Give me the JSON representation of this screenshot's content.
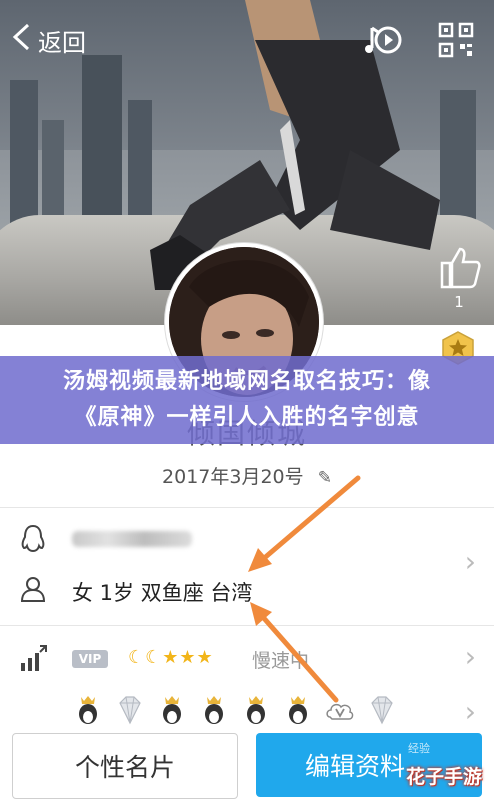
{
  "header": {
    "back_label": "返回",
    "icons": [
      "chevron-left-icon",
      "music-note-icon",
      "qr-code-icon"
    ]
  },
  "like": {
    "count": "1",
    "icon": "thumbs-up-icon"
  },
  "banner": {
    "line1": "汤姆视频最新地域网名取名技巧：像",
    "line2": "《原神》一样引人入胜的名字创意"
  },
  "profile": {
    "nickname": "倾国倾城",
    "date": "2017年3月20号",
    "edit_icon": "pencil-icon"
  },
  "info": {
    "qq_icon": "penguin-outline-icon",
    "person_icon": "person-outline-icon",
    "details": "女  1岁  双鱼座  台湾",
    "level_icon": "bar-chart-up-icon",
    "vip_label": "VIP",
    "level_glyphs": "☾☾★★★",
    "speed_text": "慢速中"
  },
  "buttons": {
    "profile_card": "个性名片",
    "edit_profile": "编辑资料"
  },
  "watermark": {
    "text": "花子手游",
    "faint_text": "经验"
  },
  "colors": {
    "banner": "#706cce",
    "edit_button": "#20a8ec",
    "arrow": "#f08a3c",
    "level_star": "#f2b519"
  }
}
